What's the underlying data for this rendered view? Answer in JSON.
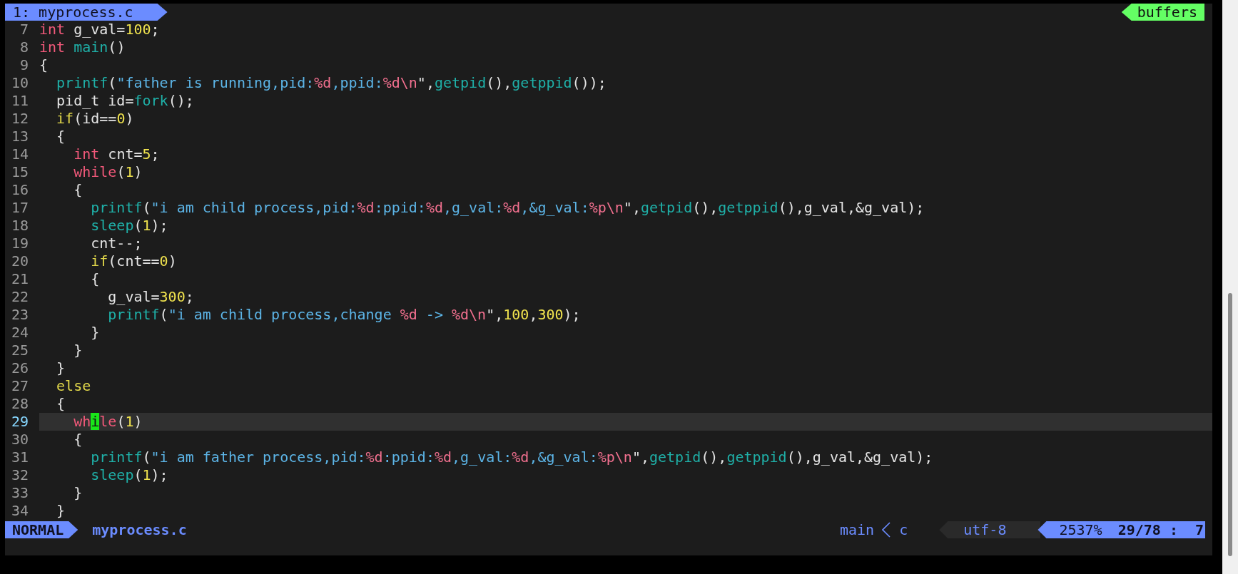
{
  "tabline": {
    "tab": {
      "label": "1: myprocess.c",
      "selected": true
    },
    "buffers_label": "buffers"
  },
  "lines": [
    {
      "number": "7",
      "current": false,
      "tokens": [
        {
          "kind": "keyword",
          "text": "int"
        },
        {
          "kind": "plain",
          "text": " g_val="
        },
        {
          "kind": "number",
          "text": "100"
        },
        {
          "kind": "plain",
          "text": ";"
        }
      ]
    },
    {
      "number": "8",
      "current": false,
      "tokens": [
        {
          "kind": "keyword",
          "text": "int "
        },
        {
          "kind": "function",
          "text": "main"
        },
        {
          "kind": "plain",
          "text": "()"
        }
      ]
    },
    {
      "number": "9",
      "current": false,
      "tokens": [
        {
          "kind": "plain",
          "text": "{"
        }
      ]
    },
    {
      "number": "10",
      "current": false,
      "tokens": [
        {
          "kind": "function",
          "text": "  printf"
        },
        {
          "kind": "plain",
          "text": "("
        },
        {
          "kind": "string",
          "text": "\"father is running,pid:"
        },
        {
          "kind": "format",
          "text": "%d"
        },
        {
          "kind": "string",
          "text": ",ppid:"
        },
        {
          "kind": "format",
          "text": "%d\\n"
        },
        {
          "kind": "plain",
          "text": "\","
        },
        {
          "kind": "function",
          "text": "getpid"
        },
        {
          "kind": "plain",
          "text": "(),"
        },
        {
          "kind": "function",
          "text": "getppid"
        },
        {
          "kind": "plain",
          "text": "());"
        }
      ]
    },
    {
      "number": "11",
      "current": false,
      "tokens": [
        {
          "kind": "plain",
          "text": "  pid_t id="
        },
        {
          "kind": "function",
          "text": "fork"
        },
        {
          "kind": "plain",
          "text": "();"
        }
      ]
    },
    {
      "number": "12",
      "current": false,
      "tokens": [
        {
          "kind": "conditional",
          "text": "  if"
        },
        {
          "kind": "plain",
          "text": "(id=="
        },
        {
          "kind": "number",
          "text": "0"
        },
        {
          "kind": "plain",
          "text": ")"
        }
      ]
    },
    {
      "number": "13",
      "current": false,
      "tokens": [
        {
          "kind": "plain",
          "text": "  {"
        }
      ]
    },
    {
      "number": "14",
      "current": false,
      "tokens": [
        {
          "kind": "keyword",
          "text": "    int"
        },
        {
          "kind": "plain",
          "text": " cnt="
        },
        {
          "kind": "number",
          "text": "5"
        },
        {
          "kind": "plain",
          "text": ";"
        }
      ]
    },
    {
      "number": "15",
      "current": false,
      "tokens": [
        {
          "kind": "keyword",
          "text": "    while"
        },
        {
          "kind": "plain",
          "text": "("
        },
        {
          "kind": "number",
          "text": "1"
        },
        {
          "kind": "plain",
          "text": ")"
        }
      ]
    },
    {
      "number": "16",
      "current": false,
      "tokens": [
        {
          "kind": "plain",
          "text": "    {"
        }
      ]
    },
    {
      "number": "17",
      "current": false,
      "tokens": [
        {
          "kind": "function",
          "text": "      printf"
        },
        {
          "kind": "plain",
          "text": "("
        },
        {
          "kind": "string",
          "text": "\"i am child process,pid:"
        },
        {
          "kind": "format",
          "text": "%d"
        },
        {
          "kind": "string",
          "text": ":ppid:"
        },
        {
          "kind": "format",
          "text": "%d"
        },
        {
          "kind": "string",
          "text": ",g_val:"
        },
        {
          "kind": "format",
          "text": "%d"
        },
        {
          "kind": "string",
          "text": ",&g_val:"
        },
        {
          "kind": "format",
          "text": "%p\\n"
        },
        {
          "kind": "plain",
          "text": "\","
        },
        {
          "kind": "function",
          "text": "getpid"
        },
        {
          "kind": "plain",
          "text": "(),"
        },
        {
          "kind": "function",
          "text": "getppid"
        },
        {
          "kind": "plain",
          "text": "(),g_val,&g_val);"
        }
      ]
    },
    {
      "number": "18",
      "current": false,
      "tokens": [
        {
          "kind": "function",
          "text": "      sleep"
        },
        {
          "kind": "plain",
          "text": "("
        },
        {
          "kind": "number",
          "text": "1"
        },
        {
          "kind": "plain",
          "text": ");"
        }
      ]
    },
    {
      "number": "19",
      "current": false,
      "tokens": [
        {
          "kind": "plain",
          "text": "      cnt--;"
        }
      ]
    },
    {
      "number": "20",
      "current": false,
      "tokens": [
        {
          "kind": "conditional",
          "text": "      if"
        },
        {
          "kind": "plain",
          "text": "(cnt=="
        },
        {
          "kind": "number",
          "text": "0"
        },
        {
          "kind": "plain",
          "text": ")"
        }
      ]
    },
    {
      "number": "21",
      "current": false,
      "tokens": [
        {
          "kind": "plain",
          "text": "      {"
        }
      ]
    },
    {
      "number": "22",
      "current": false,
      "tokens": [
        {
          "kind": "plain",
          "text": "        g_val="
        },
        {
          "kind": "number",
          "text": "300"
        },
        {
          "kind": "plain",
          "text": ";"
        }
      ]
    },
    {
      "number": "23",
      "current": false,
      "tokens": [
        {
          "kind": "function",
          "text": "        printf"
        },
        {
          "kind": "plain",
          "text": "("
        },
        {
          "kind": "string",
          "text": "\"i am child process,change "
        },
        {
          "kind": "format",
          "text": "%d"
        },
        {
          "kind": "string",
          "text": " -> "
        },
        {
          "kind": "format",
          "text": "%d\\n"
        },
        {
          "kind": "plain",
          "text": "\","
        },
        {
          "kind": "number",
          "text": "100"
        },
        {
          "kind": "plain",
          "text": ","
        },
        {
          "kind": "number",
          "text": "300"
        },
        {
          "kind": "plain",
          "text": ");"
        }
      ]
    },
    {
      "number": "24",
      "current": false,
      "tokens": [
        {
          "kind": "plain",
          "text": "      }"
        }
      ]
    },
    {
      "number": "25",
      "current": false,
      "tokens": [
        {
          "kind": "plain",
          "text": "    }"
        }
      ]
    },
    {
      "number": "26",
      "current": false,
      "tokens": [
        {
          "kind": "plain",
          "text": "  }"
        }
      ]
    },
    {
      "number": "27",
      "current": false,
      "tokens": [
        {
          "kind": "conditional",
          "text": "  else"
        }
      ]
    },
    {
      "number": "28",
      "current": false,
      "tokens": [
        {
          "kind": "plain",
          "text": "  {"
        }
      ]
    },
    {
      "number": "29",
      "current": true,
      "tokens": [
        {
          "kind": "keyword",
          "text": "    wh"
        },
        {
          "kind": "cursor",
          "text": "i"
        },
        {
          "kind": "keyword",
          "text": "le"
        },
        {
          "kind": "plain",
          "text": "("
        },
        {
          "kind": "number",
          "text": "1"
        },
        {
          "kind": "plain",
          "text": ")"
        }
      ]
    },
    {
      "number": "30",
      "current": false,
      "tokens": [
        {
          "kind": "plain",
          "text": "    {"
        }
      ]
    },
    {
      "number": "31",
      "current": false,
      "tokens": [
        {
          "kind": "function",
          "text": "      printf"
        },
        {
          "kind": "plain",
          "text": "("
        },
        {
          "kind": "string",
          "text": "\"i am father process,pid:"
        },
        {
          "kind": "format",
          "text": "%d"
        },
        {
          "kind": "string",
          "text": ":ppid:"
        },
        {
          "kind": "format",
          "text": "%d"
        },
        {
          "kind": "string",
          "text": ",g_val:"
        },
        {
          "kind": "format",
          "text": "%d"
        },
        {
          "kind": "string",
          "text": ",&g_val:"
        },
        {
          "kind": "format",
          "text": "%p\\n"
        },
        {
          "kind": "plain",
          "text": "\","
        },
        {
          "kind": "function",
          "text": "getpid"
        },
        {
          "kind": "plain",
          "text": "(),"
        },
        {
          "kind": "function",
          "text": "getppid"
        },
        {
          "kind": "plain",
          "text": "(),g_val,&g_val);"
        }
      ]
    },
    {
      "number": "32",
      "current": false,
      "tokens": [
        {
          "kind": "function",
          "text": "      sleep"
        },
        {
          "kind": "plain",
          "text": "("
        },
        {
          "kind": "number",
          "text": "1"
        },
        {
          "kind": "plain",
          "text": ");"
        }
      ]
    },
    {
      "number": "33",
      "current": false,
      "tokens": [
        {
          "kind": "plain",
          "text": "    }"
        }
      ]
    },
    {
      "number": "34",
      "current": false,
      "tokens": [
        {
          "kind": "plain",
          "text": "  }"
        }
      ]
    }
  ],
  "status_bar": {
    "mode": "NORMAL",
    "file_name": "myprocess.c",
    "function": "main",
    "filetype": "c",
    "encoding": "utf-8",
    "percent": "2537%",
    "position": "29/78 :",
    "column": "7"
  }
}
